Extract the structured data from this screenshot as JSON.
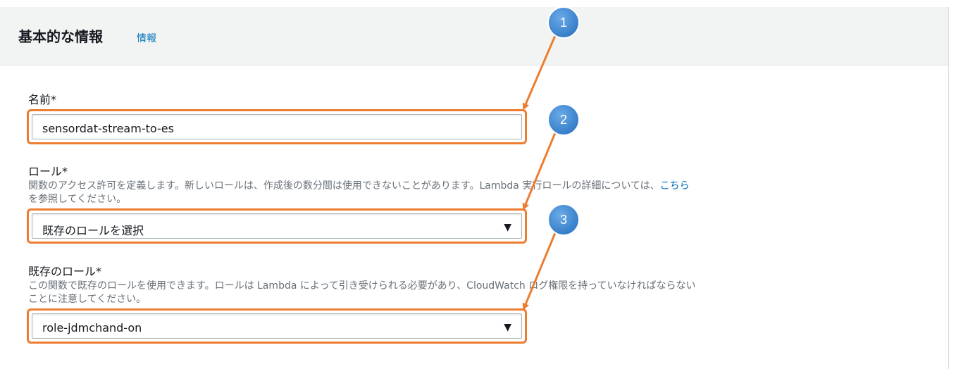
{
  "section": {
    "title": "基本的な情報",
    "info_link": "情報"
  },
  "name_field": {
    "label": "名前*",
    "value": "sensordat-stream-to-es"
  },
  "role_field": {
    "label": "ロール*",
    "description_before_link": "関数のアクセス許可を定義します。新しいロールは、作成後の数分間は使用できないことがあります。Lambda 実行ロールの詳細については、",
    "description_link": "こちら",
    "description_after_link": "を参照してください。",
    "selected": "既存のロールを選択"
  },
  "existing_role_field": {
    "label": "既存のロール*",
    "description": "この関数で既存のロールを使用できます。ロールは Lambda によって引き受けられる必要があり、CloudWatch ログ権限を持っていなければならないことに注意してください。",
    "selected": "role-jdmchand-on"
  },
  "annotations": {
    "badges": [
      "1",
      "2",
      "3"
    ],
    "highlight_color": "#ed7d31",
    "badge_color": "#3b86d4",
    "arrow_color": "#ed7d31"
  },
  "icons": {
    "dropdown": "▼"
  }
}
